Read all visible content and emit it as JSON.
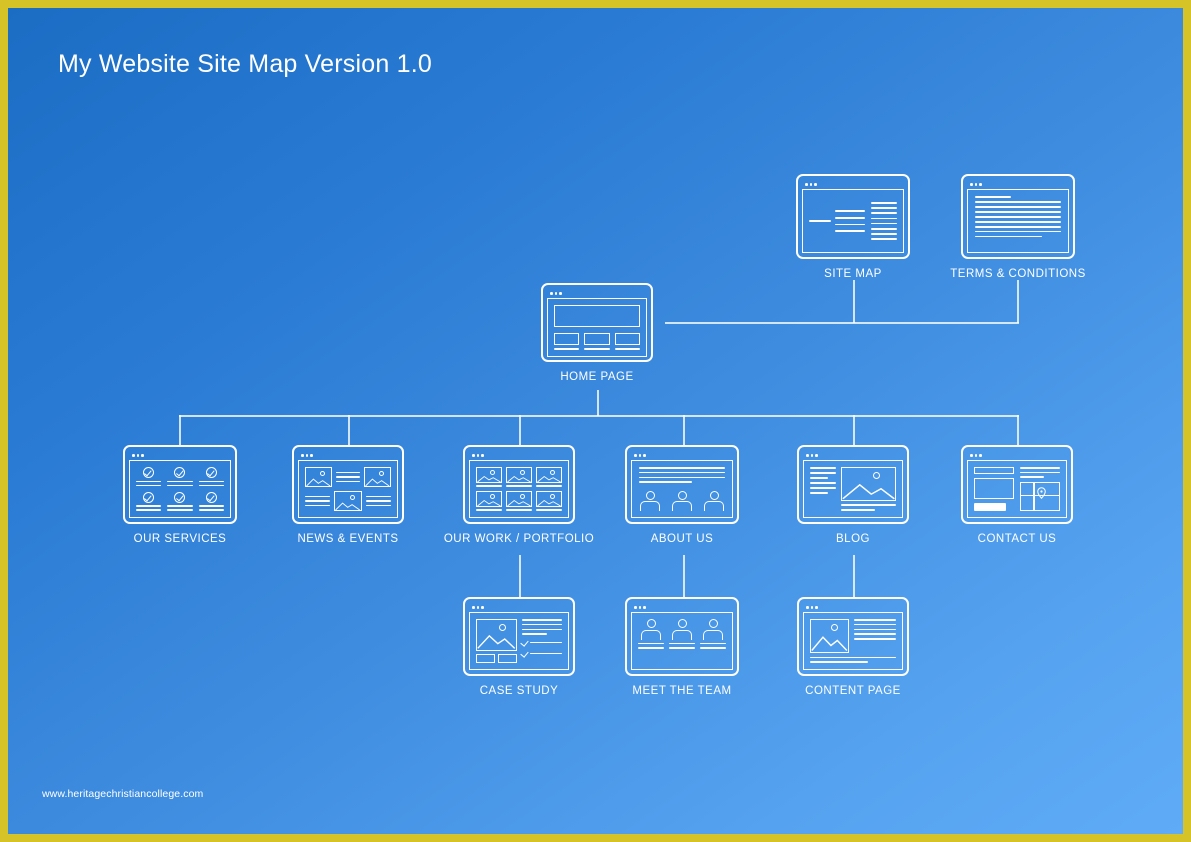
{
  "page": {
    "title": "My Website Site Map Version 1.0",
    "footer": "www.heritagechristiancollege.com",
    "border_color": "#d6c328",
    "bg_gradient_from": "#1b6dc4",
    "bg_gradient_to": "#5fabf7",
    "line_color": "#ffffff"
  },
  "nodes": {
    "site_map": {
      "label": "SITE MAP",
      "icon": "sitemap-tree-page-icon"
    },
    "terms": {
      "label": "TERMS & CONDITIONS",
      "icon": "text-document-page-icon"
    },
    "home": {
      "label": "HOME PAGE",
      "icon": "hero-three-column-page-icon"
    },
    "services": {
      "label": "OUR SERVICES",
      "icon": "checklist-grid-page-icon"
    },
    "news": {
      "label": "NEWS & EVENTS",
      "icon": "news-thumbnails-page-icon"
    },
    "portfolio": {
      "label": "OUR WORK / PORTFOLIO",
      "icon": "image-grid-page-icon"
    },
    "about": {
      "label": "ABOUT US",
      "icon": "text-and-people-page-icon"
    },
    "blog": {
      "label": "BLOG",
      "icon": "article-with-image-page-icon"
    },
    "contact": {
      "label": "CONTACT US",
      "icon": "form-and-map-page-icon"
    },
    "case_study": {
      "label": "CASE STUDY",
      "icon": "image-and-checklist-page-icon"
    },
    "meet_team": {
      "label": "MEET THE TEAM",
      "icon": "team-people-page-icon"
    },
    "content_page": {
      "label": "CONTENT PAGE",
      "icon": "image-left-text-page-icon"
    }
  },
  "hierarchy": {
    "root": "HOME PAGE",
    "top_level_siblings": [
      "SITE MAP",
      "TERMS & CONDITIONS"
    ],
    "children_of_home": [
      "OUR SERVICES",
      "NEWS & EVENTS",
      "OUR WORK / PORTFOLIO",
      "ABOUT US",
      "BLOG",
      "CONTACT US"
    ],
    "children_of_portfolio": [
      "CASE STUDY"
    ],
    "children_of_about": [
      "MEET THE TEAM"
    ],
    "children_of_blog": [
      "CONTENT PAGE"
    ]
  }
}
